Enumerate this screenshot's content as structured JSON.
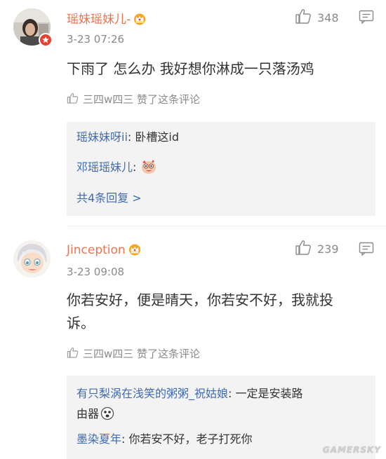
{
  "comments": [
    {
      "username": "瑶妹瑶妹儿-",
      "timestamp": "3-23 07:26",
      "likes": "348",
      "content": "下雨了 怎么办 我好想你淋成一只落汤鸡",
      "liked_by": "三四w四三 赞了这条评论",
      "replies": [
        {
          "name": "瑶妹妹呀ii",
          "sep": ": ",
          "text": "卧槽这id"
        },
        {
          "name": "邓瑶瑶妹儿",
          "sep": ": ",
          "text": ""
        }
      ],
      "more_replies": "共4条回复 >"
    },
    {
      "username": "Jinception",
      "timestamp": "3-23 09:08",
      "likes": "239",
      "content_line1": "你若安好，便是晴天，你若安不好，我就投",
      "content_line2": "诉。",
      "liked_by": "三四w四三 赞了这条评论",
      "replies": [
        {
          "name": "有只梨涡在浅笑的粥粥_祝姑娘",
          "sep": ": ",
          "text": "一定是安装路",
          "text2": "由器"
        },
        {
          "name": "墨染夏年",
          "sep": ": ",
          "text": "你若安不好，老子打死你"
        }
      ]
    }
  ],
  "watermark": "GAMERSKY",
  "icons": {
    "like": "thumbs-up-icon",
    "reply": "comment-icon",
    "crown": "crown-badge-icon",
    "verified": "verified-badge-icon",
    "sticker": "emoji-sticker-icon"
  },
  "colors": {
    "username": "#eb7350",
    "reply_name": "#3f6bb2",
    "meta": "#8a8a8a",
    "reply_bg": "#f3f3f3"
  }
}
